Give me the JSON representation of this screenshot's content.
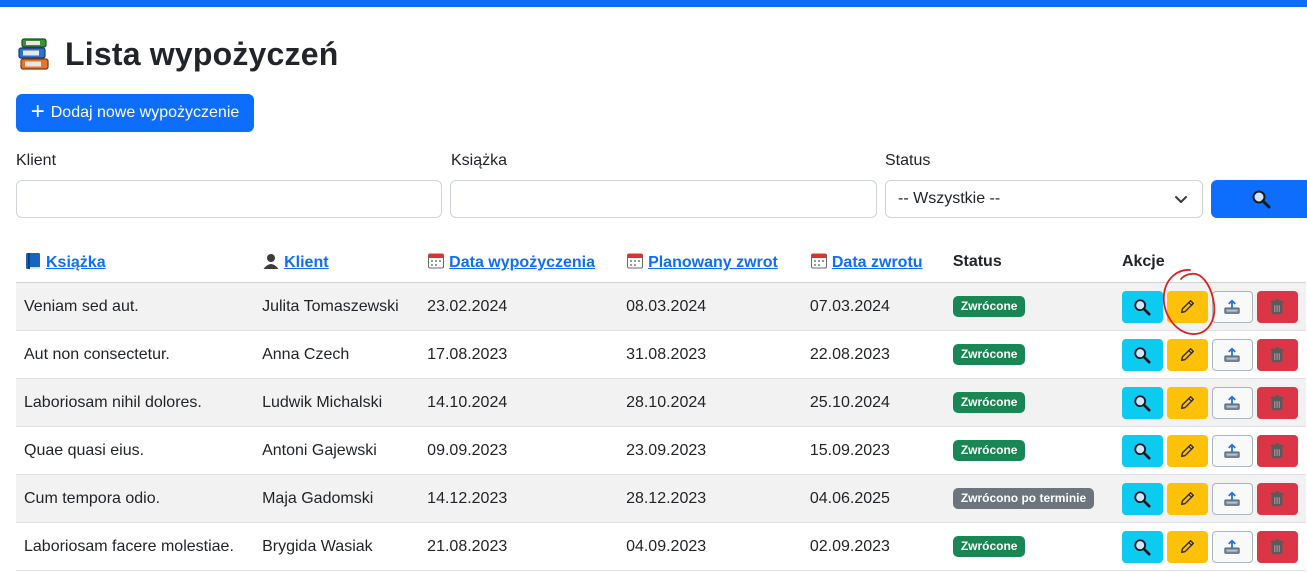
{
  "page": {
    "title": "Lista wypożyczeń",
    "title_icon": "books-icon"
  },
  "toolbar": {
    "add_label": "Dodaj nowe wypożyczenie"
  },
  "filters": {
    "client_label": "Klient",
    "client_value": "",
    "book_label": "Książka",
    "book_value": "",
    "status_label": "Status",
    "status_selected": "-- Wszystkie --",
    "search_icon": "search-icon"
  },
  "table": {
    "headers": {
      "book": "Książka",
      "client": "Klient",
      "loan_date": "Data wypożyczenia",
      "planned_return": "Planowany zwrot",
      "return_date": "Data zwrotu",
      "status": "Status",
      "actions": "Akcje"
    },
    "rows": [
      {
        "book": "Veniam sed aut.",
        "client": "Julita Tomaszewski",
        "loan_date": "23.02.2024",
        "planned_return": "08.03.2024",
        "return_date": "07.03.2024",
        "status": "Zwrócone",
        "status_type": "green"
      },
      {
        "book": "Aut non consectetur.",
        "client": "Anna Czech",
        "loan_date": "17.08.2023",
        "planned_return": "31.08.2023",
        "return_date": "22.08.2023",
        "status": "Zwrócone",
        "status_type": "green"
      },
      {
        "book": "Laboriosam nihil dolores.",
        "client": "Ludwik Michalski",
        "loan_date": "14.10.2024",
        "planned_return": "28.10.2024",
        "return_date": "25.10.2024",
        "status": "Zwrócone",
        "status_type": "green"
      },
      {
        "book": "Quae quasi eius.",
        "client": "Antoni Gajewski",
        "loan_date": "09.09.2023",
        "planned_return": "23.09.2023",
        "return_date": "15.09.2023",
        "status": "Zwrócone",
        "status_type": "green"
      },
      {
        "book": "Cum tempora odio.",
        "client": "Maja Gadomski",
        "loan_date": "14.12.2023",
        "planned_return": "28.12.2023",
        "return_date": "04.06.2025",
        "status": "Zwrócono po terminie",
        "status_type": "gray"
      },
      {
        "book": "Laboriosam facere molestiae.",
        "client": "Brygida Wasiak",
        "loan_date": "21.08.2023",
        "planned_return": "04.09.2023",
        "return_date": "02.09.2023",
        "status": "Zwrócone",
        "status_type": "green"
      }
    ]
  },
  "colors": {
    "primary": "#0d6efd",
    "info": "#0dcaf0",
    "warning": "#ffc107",
    "danger": "#dc3545",
    "success": "#198754",
    "secondary": "#6c757d",
    "annotation": "#e02020"
  }
}
